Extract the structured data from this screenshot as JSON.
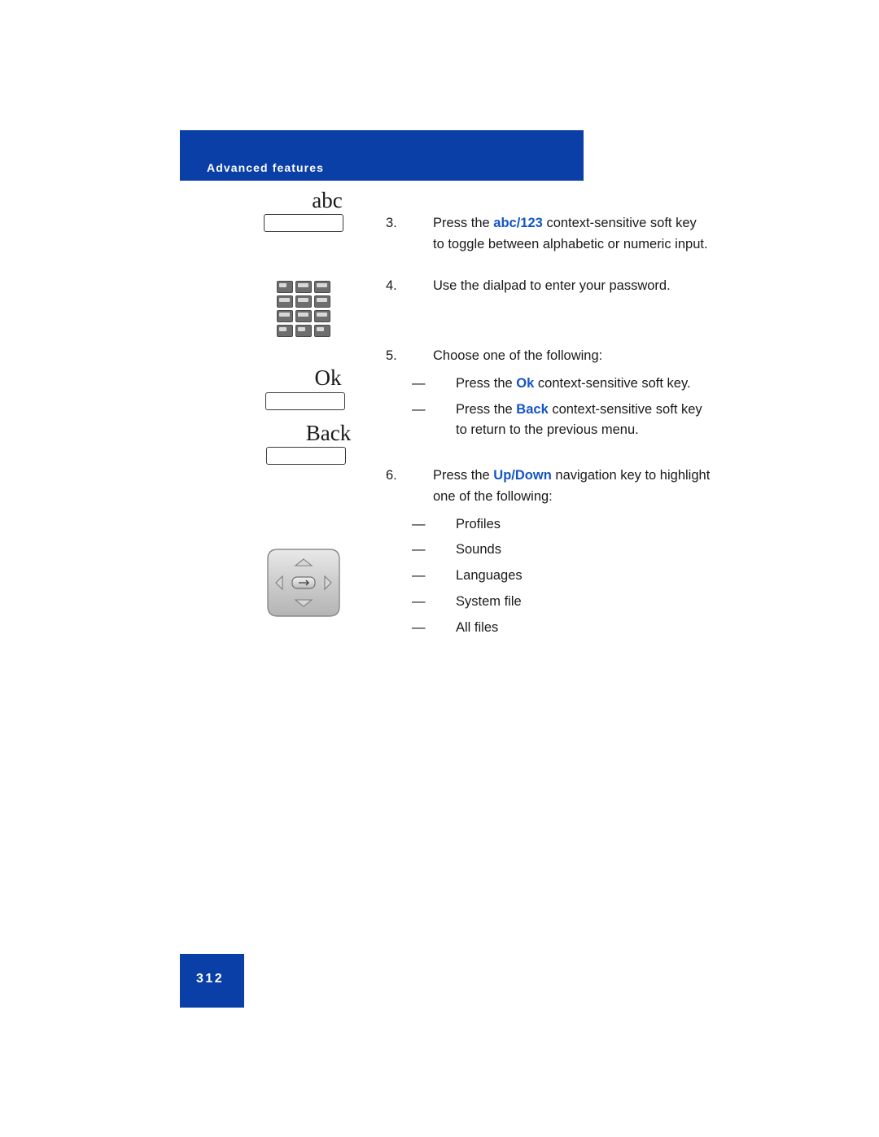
{
  "header": {
    "title": "Advanced features"
  },
  "footer": {
    "page_number": "312"
  },
  "icons": {
    "abc_softkey_label": "abc",
    "ok_softkey_label": "Ok",
    "back_softkey_label": "Back",
    "dialpad_name": "dialpad",
    "navigation_cluster_name": "navigation-key-cluster"
  },
  "steps": [
    {
      "number": "3.",
      "parts": [
        {
          "text": "Press the ",
          "style": "plain"
        },
        {
          "text": "abc",
          "style": "keyword"
        },
        {
          "text": "/",
          "style": "keyword"
        },
        {
          "text": "123",
          "style": "keyword"
        },
        {
          "text": " context-sensitive soft key to toggle between alphabetic or numeric input.",
          "style": "plain"
        }
      ]
    },
    {
      "number": "4.",
      "parts": [
        {
          "text": "Use the dialpad to enter your password.",
          "style": "plain"
        }
      ]
    },
    {
      "number": "5.",
      "parts": [
        {
          "text": "Choose one of the following:",
          "style": "plain"
        }
      ]
    },
    {
      "number": "6.",
      "parts": [
        {
          "text": "Press the ",
          "style": "plain"
        },
        {
          "text": "Up",
          "style": "keyword"
        },
        {
          "text": "/",
          "style": "keyword"
        },
        {
          "text": "Down",
          "style": "keyword"
        },
        {
          "text": " navigation key to highlight one of the following:",
          "style": "plain"
        }
      ]
    }
  ],
  "step5_bullets": [
    {
      "parts": [
        {
          "text": "Press the ",
          "style": "plain"
        },
        {
          "text": "Ok",
          "style": "keyword"
        },
        {
          "text": " context-sensitive soft key.",
          "style": "plain"
        }
      ]
    },
    {
      "parts": [
        {
          "text": "Press the ",
          "style": "plain"
        },
        {
          "text": "Back",
          "style": "keyword"
        },
        {
          "text": " context-sensitive soft key to return to the previous menu.",
          "style": "plain"
        }
      ]
    }
  ],
  "step6_bullets": [
    {
      "text": "Profiles"
    },
    {
      "text": "Sounds"
    },
    {
      "text": " Languages"
    },
    {
      "text": "System file"
    },
    {
      "text": "All files"
    }
  ],
  "colors": {
    "brand_blue": "#0b3fa8",
    "keyword_blue": "#1455c4"
  },
  "bullet_dash": "—"
}
